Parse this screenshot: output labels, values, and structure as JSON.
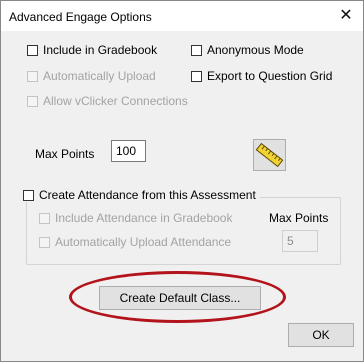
{
  "window": {
    "title": "Advanced Engage Options",
    "close_glyph": "✕"
  },
  "options": {
    "include_gradebook": "Include in Gradebook",
    "anonymous_mode": "Anonymous Mode",
    "auto_upload": "Automatically Upload",
    "export_grid": "Export to Question Grid",
    "allow_vclicker": "Allow vClicker Connections"
  },
  "max_points": {
    "label": "Max Points",
    "value": "100"
  },
  "attendance": {
    "create_label": "Create Attendance from this Assessment",
    "include_gradebook": "Include Attendance in Gradebook",
    "auto_upload": "Automatically Upload Attendance",
    "max_points_label": "Max Points",
    "max_points_value": "5"
  },
  "buttons": {
    "create_default_class": "Create Default Class...",
    "ok": "OK"
  },
  "icons": {
    "ruler": "ruler-icon"
  },
  "colors": {
    "highlight_oval": "#b3131a",
    "ruler_yellow": "#f2d233"
  }
}
